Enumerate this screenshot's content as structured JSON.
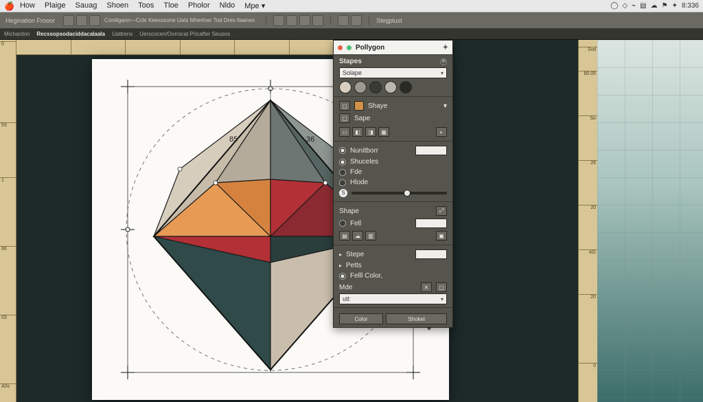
{
  "os_menu": {
    "items": [
      "How",
      "Plaige",
      "Sauag",
      "Shoen",
      "Toos",
      "Tloe",
      "Pholor",
      "Nldo",
      "Mpe"
    ],
    "more_glyph": "▾",
    "tray": {
      "icons": [
        "◯",
        "◇",
        "⌁",
        "▤",
        "☁",
        "⚑",
        "✦"
      ],
      "time": "8:336"
    }
  },
  "toolbar": {
    "label_left": "Hegination Frooor",
    "label_mid": "Coniligann—Ccle   Keexssone   Uats   Mhertner  Tod   Dres   Itaanes",
    "label_right": "Stegplust"
  },
  "tabs": {
    "items": [
      "Michardon",
      "Recssopsodaciddacalaala",
      "Uattrens",
      "Uerscocen/Oorrscat Pricafter Seusos"
    ],
    "active_index": 1
  },
  "ruler": {
    "left_ticks": [
      "0",
      "53",
      "1",
      "66",
      "03",
      "A0s"
    ],
    "top_ticks": [
      "",
      "",
      "",
      "",
      "",
      "",
      "",
      "",
      "",
      ""
    ],
    "right_ticks": [
      "Svd",
      "80.05",
      "So",
      "26",
      "20",
      "AG",
      "20",
      "0"
    ]
  },
  "artboard": {
    "label_left": "85",
    "label_right": "36",
    "asterisk": "*"
  },
  "panel": {
    "title": "Pollygon",
    "shapes_header": "Stapes",
    "shapes_dropdown": "Solape",
    "swatches": [
      "#d8cfc0",
      "#9a9a92",
      "#3a3a34",
      "#b8b8b0",
      "#2a2a24"
    ],
    "shape_group": {
      "label1": "Shaye",
      "label2": "Sape"
    },
    "number_label": "Nunitborr",
    "sides_label": "Shuceles",
    "fde_label": "Fde",
    "hode_label": "Hlode",
    "shape_label2": "Shape",
    "fell_label": "Fell",
    "stype_label": "Stepe",
    "pets_label": "Petts",
    "fill_color_label": "Felll Color,",
    "mde_label": "Mde",
    "mde_value": "utl:",
    "color_label": "Color",
    "color_button": "Shokel"
  }
}
